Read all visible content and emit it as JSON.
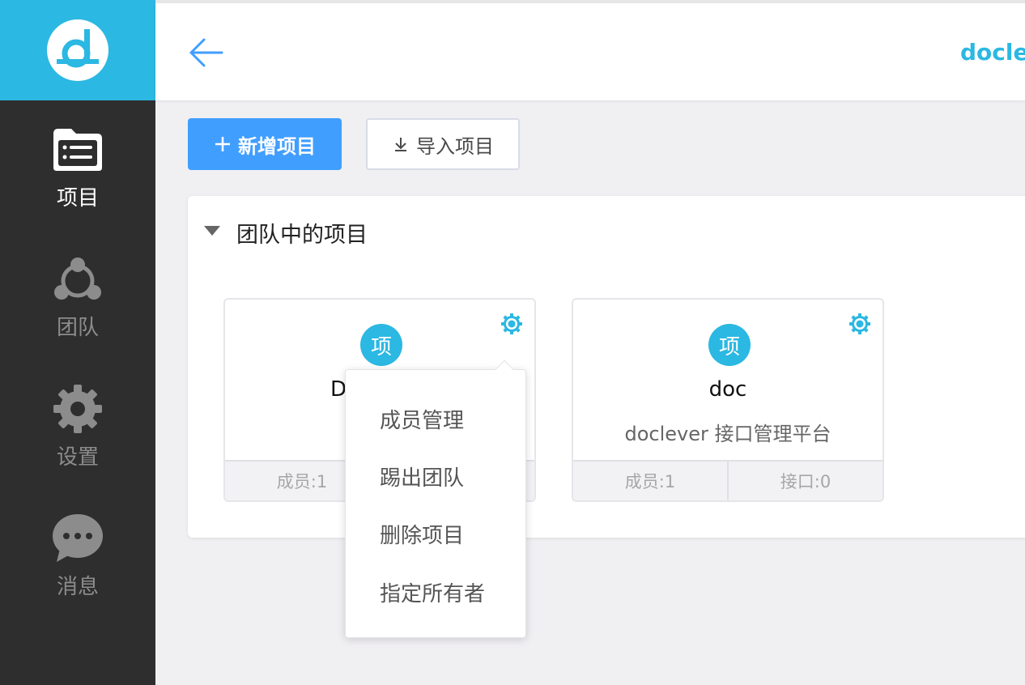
{
  "brand": {
    "name": "doclever"
  },
  "colors": {
    "accent": "#2bb8e2",
    "primary_button": "#409eff",
    "sidebar_bg": "#2e2e2e"
  },
  "sidebar": {
    "items": [
      {
        "label": "项目",
        "icon": "project-list-icon",
        "active": true
      },
      {
        "label": "团队",
        "icon": "team-icon",
        "active": false
      },
      {
        "label": "设置",
        "icon": "gear-icon",
        "active": false
      },
      {
        "label": "消息",
        "icon": "message-icon",
        "active": false
      }
    ]
  },
  "toolbar": {
    "add_label": "新增项目",
    "import_label": "导入项目"
  },
  "panel": {
    "title": "团队中的项目",
    "cards": [
      {
        "avatar_text": "项",
        "name": "D",
        "description": "",
        "members": "成员:1",
        "interfaces": ""
      },
      {
        "avatar_text": "项",
        "name": "doc",
        "description": "doclever 接口管理平台",
        "members": "成员:1",
        "interfaces": "接口:0"
      }
    ]
  },
  "dropdown": {
    "items": [
      "成员管理",
      "踢出团队",
      "删除项目",
      "指定所有者"
    ]
  }
}
